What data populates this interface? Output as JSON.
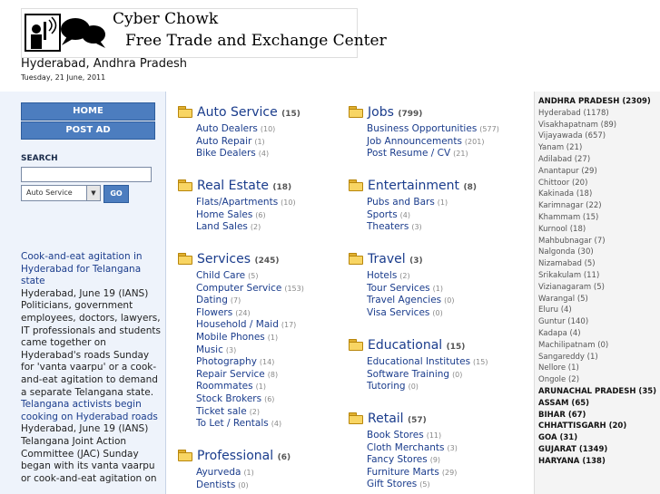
{
  "header": {
    "logo_line1": "Cyber Chowk",
    "logo_line2": "Free Trade and Exchange Center",
    "city": "Hyderabad, Andhra Pradesh",
    "date": "Tuesday, 21 June, 2011"
  },
  "nav": {
    "home": "HOME",
    "post_ad": "POST AD"
  },
  "search": {
    "label": "SEARCH",
    "input_value": "",
    "category_selected": "Auto Service",
    "go_label": "GO",
    "dropdown_arrow": "▼"
  },
  "news": [
    {
      "headline": "Cook-and-eat agitation in Hyderabad for Telangana state",
      "body": "Hyderabad, June 19 (IANS) Politicians, government employees, doctors, lawyers, IT professionals and students came together on Hyderabad's roads Sunday for 'vanta vaarpu' or a cook-and-eat agitation to demand a separate Telangana state."
    },
    {
      "headline": "Telangana activists begin cooking on Hyderabad roads",
      "body": "Hyderabad, June 19 (IANS) Telangana Joint Action Committee (JAC) Sunday began with its vanta vaarpu or cook-and-eat agitation on"
    }
  ],
  "categories": {
    "auto_service": {
      "title": "Auto Service",
      "count": "(15)",
      "items": [
        {
          "name": "Auto Dealers",
          "count": "(10)"
        },
        {
          "name": "Auto Repair",
          "count": "(1)"
        },
        {
          "name": "Bike Dealers",
          "count": "(4)"
        }
      ]
    },
    "real_estate": {
      "title": "Real Estate",
      "count": "(18)",
      "items": [
        {
          "name": "Flats/Apartments",
          "count": "(10)"
        },
        {
          "name": "Home Sales",
          "count": "(6)"
        },
        {
          "name": "Land Sales",
          "count": "(2)"
        }
      ]
    },
    "services": {
      "title": "Services",
      "count": "(245)",
      "items": [
        {
          "name": "Child Care",
          "count": "(5)"
        },
        {
          "name": "Computer Service",
          "count": "(153)"
        },
        {
          "name": "Dating",
          "count": "(7)"
        },
        {
          "name": "Flowers",
          "count": "(24)"
        },
        {
          "name": "Household / Maid",
          "count": "(17)"
        },
        {
          "name": "Mobile Phones",
          "count": "(1)"
        },
        {
          "name": "Music",
          "count": "(3)"
        },
        {
          "name": "Photography",
          "count": "(14)"
        },
        {
          "name": "Repair Service",
          "count": "(8)"
        },
        {
          "name": "Roommates",
          "count": "(1)"
        },
        {
          "name": "Stock Brokers",
          "count": "(6)"
        },
        {
          "name": "Ticket sale",
          "count": "(2)"
        },
        {
          "name": "To Let / Rentals",
          "count": "(4)"
        }
      ]
    },
    "professional": {
      "title": "Professional",
      "count": "(6)",
      "items": [
        {
          "name": "Ayurveda",
          "count": "(1)"
        },
        {
          "name": "Dentists",
          "count": "(0)"
        }
      ]
    },
    "jobs": {
      "title": "Jobs",
      "count": "(799)",
      "items": [
        {
          "name": "Business Opportunities",
          "count": "(577)"
        },
        {
          "name": "Job Announcements",
          "count": "(201)"
        },
        {
          "name": "Post Resume / CV",
          "count": "(21)"
        }
      ]
    },
    "entertainment": {
      "title": "Entertainment",
      "count": "(8)",
      "items": [
        {
          "name": "Pubs and Bars",
          "count": "(1)"
        },
        {
          "name": "Sports",
          "count": "(4)"
        },
        {
          "name": "Theaters",
          "count": "(3)"
        }
      ]
    },
    "travel": {
      "title": "Travel",
      "count": "(3)",
      "items": [
        {
          "name": "Hotels",
          "count": "(2)"
        },
        {
          "name": "Tour Services",
          "count": "(1)"
        },
        {
          "name": "Travel Agencies",
          "count": "(0)"
        },
        {
          "name": "Visa Services",
          "count": "(0)"
        }
      ]
    },
    "educational": {
      "title": "Educational",
      "count": "(15)",
      "items": [
        {
          "name": "Educational Institutes",
          "count": "(15)"
        },
        {
          "name": "Software Training",
          "count": "(0)"
        },
        {
          "name": "Tutoring",
          "count": "(0)"
        }
      ]
    },
    "retail": {
      "title": "Retail",
      "count": "(57)",
      "items": [
        {
          "name": "Book Stores",
          "count": "(11)"
        },
        {
          "name": "Cloth Merchants",
          "count": "(3)"
        },
        {
          "name": "Fancy Stores",
          "count": "(9)"
        },
        {
          "name": "Furniture Marts",
          "count": "(29)"
        },
        {
          "name": "Gift Stores",
          "count": "(5)"
        }
      ]
    }
  },
  "states": [
    {
      "type": "state",
      "text": "ANDHRA PRADESH (2309)"
    },
    {
      "type": "city",
      "text": "Hyderabad (1178)"
    },
    {
      "type": "city",
      "text": "Visakhapatnam (89)"
    },
    {
      "type": "city",
      "text": "Vijayawada (657)"
    },
    {
      "type": "city",
      "text": "Yanam (21)"
    },
    {
      "type": "city",
      "text": "Adilabad (27)"
    },
    {
      "type": "city",
      "text": "Anantapur (29)"
    },
    {
      "type": "city",
      "text": "Chittoor (20)"
    },
    {
      "type": "city",
      "text": "Kakinada (18)"
    },
    {
      "type": "city",
      "text": "Karimnagar (22)"
    },
    {
      "type": "city",
      "text": "Khammam (15)"
    },
    {
      "type": "city",
      "text": "Kurnool (18)"
    },
    {
      "type": "city",
      "text": "Mahbubnagar (7)"
    },
    {
      "type": "city",
      "text": "Nalgonda (30)"
    },
    {
      "type": "city",
      "text": "Nizamabad (5)"
    },
    {
      "type": "city",
      "text": "Srikakulam (11)"
    },
    {
      "type": "city",
      "text": "Vizianagaram (5)"
    },
    {
      "type": "city",
      "text": "Warangal (5)"
    },
    {
      "type": "city",
      "text": "Eluru (4)"
    },
    {
      "type": "city",
      "text": "Guntur (140)"
    },
    {
      "type": "city",
      "text": "Kadapa (4)"
    },
    {
      "type": "city",
      "text": "Machilipatnam (0)"
    },
    {
      "type": "city",
      "text": "Sangareddy (1)"
    },
    {
      "type": "city",
      "text": "Nellore (1)"
    },
    {
      "type": "city",
      "text": "Ongole (2)"
    },
    {
      "type": "state",
      "text": "ARUNACHAL PRADESH (35)"
    },
    {
      "type": "state",
      "text": "ASSAM (65)"
    },
    {
      "type": "state",
      "text": "BIHAR (67)"
    },
    {
      "type": "state",
      "text": "CHHATTISGARH (20)"
    },
    {
      "type": "state",
      "text": "GOA (31)"
    },
    {
      "type": "state",
      "text": "GUJARAT (1349)"
    },
    {
      "type": "state",
      "text": "HARYANA (138)"
    }
  ]
}
